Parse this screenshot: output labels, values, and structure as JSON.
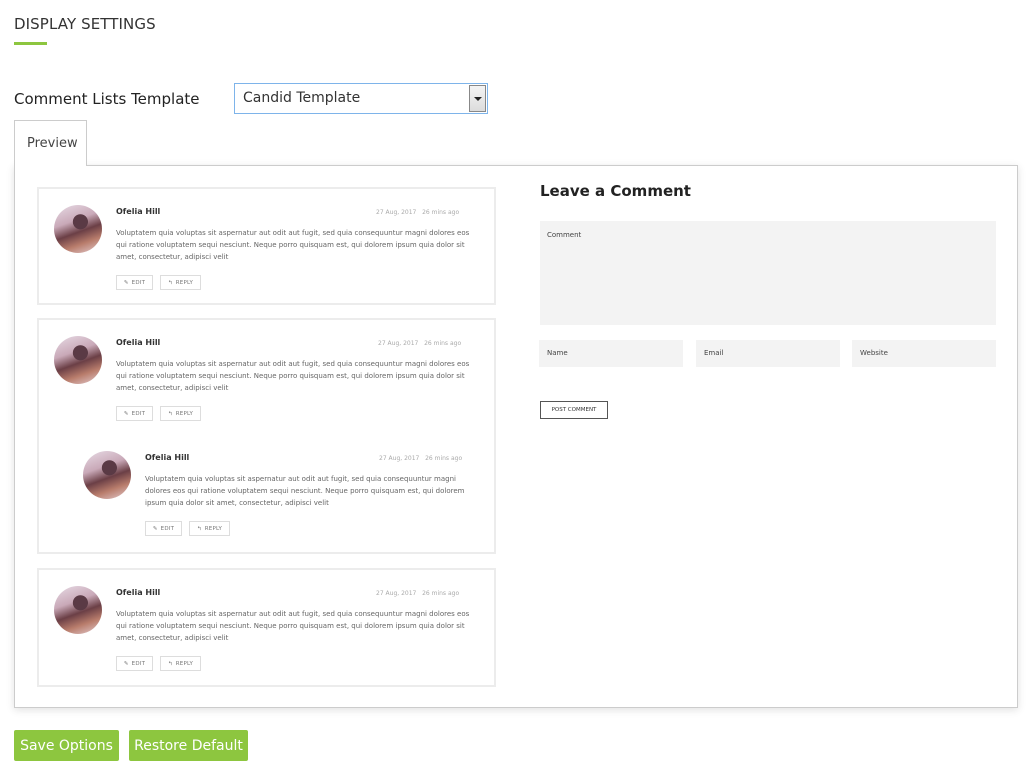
{
  "section": {
    "title": "DISPLAY SETTINGS",
    "accent_color": "#8dc63f"
  },
  "template_field": {
    "label": "Comment Lists Template",
    "selected": "Candid Template"
  },
  "tabs": [
    {
      "label": "Preview",
      "active": true
    }
  ],
  "comments": [
    {
      "author": "Ofelia Hill",
      "date": "27 Aug, 2017",
      "ago": "26 mins ago",
      "text": "Voluptatem quia voluptas sit aspernatur aut odit aut fugit, sed quia consequuntur magni dolores eos qui ratione voluptatem sequi nesciunt. Neque porro quisquam est, qui dolorem ipsum quia dolor sit amet, consectetur, adipisci velit",
      "edit": "EDIT",
      "reply": "REPLY"
    },
    {
      "author": "Ofelia Hill",
      "date": "27 Aug, 2017",
      "ago": "26 mins ago",
      "text": "Voluptatem quia voluptas sit aspernatur aut odit aut fugit, sed quia consequuntur magni dolores eos qui ratione voluptatem sequi nesciunt. Neque porro quisquam est, qui dolorem ipsum quia dolor sit amet, consectetur, adipisci velit",
      "edit": "EDIT",
      "reply": "REPLY"
    },
    {
      "author": "Ofelia Hill",
      "date": "27 Aug, 2017",
      "ago": "26 mins ago",
      "text": "Voluptatem quia voluptas sit aspernatur aut odit aut fugit, sed quia consequuntur magni dolores eos qui ratione voluptatem sequi nesciunt. Neque porro quisquam est, qui dolorem ipsum quia dolor sit amet, consectetur, adipisci velit",
      "edit": "EDIT",
      "reply": "REPLY"
    },
    {
      "author": "Ofelia Hill",
      "date": "27 Aug, 2017",
      "ago": "26 mins ago",
      "text": "Voluptatem quia voluptas sit aspernatur aut odit aut fugit, sed quia consequuntur magni dolores eos qui ratione voluptatem sequi nesciunt. Neque porro quisquam est, qui dolorem ipsum quia dolor sit amet, consectetur, adipisci velit",
      "edit": "EDIT",
      "reply": "REPLY"
    }
  ],
  "form": {
    "title": "Leave a Comment",
    "comment_placeholder": "Comment",
    "name_placeholder": "Name",
    "email_placeholder": "Email",
    "website_placeholder": "Website",
    "submit": "POST COMMENT"
  },
  "actions": {
    "save": "Save Options",
    "restore": "Restore Default"
  }
}
